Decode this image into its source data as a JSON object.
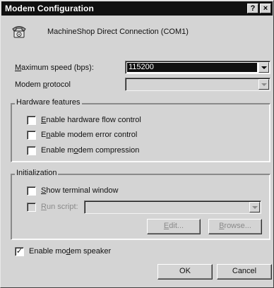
{
  "window": {
    "title": "Modem Configuration",
    "help_label": "?",
    "close_label": "×"
  },
  "device": {
    "icon": "phone-icon",
    "name": "MachineShop Direct Connection (COM1)"
  },
  "speed": {
    "label": "Maximum speed (bps):",
    "value": "115200"
  },
  "protocol": {
    "label": "Modem protocol",
    "value": ""
  },
  "hardware": {
    "legend": "Hardware features",
    "flow_control": {
      "label": "Enable hardware flow control",
      "checked": false
    },
    "error_control": {
      "label": "Enable modem error control",
      "checked": false
    },
    "compression": {
      "label": "Enable modem compression",
      "checked": false
    }
  },
  "init": {
    "legend": "Initialization",
    "show_terminal": {
      "label": "Show terminal window",
      "checked": false
    },
    "run_script": {
      "label": "Run script:",
      "checked": false,
      "value": ""
    },
    "edit_label": "Edit...",
    "browse_label": "Browse..."
  },
  "speaker": {
    "label": "Enable modem speaker",
    "checked": true,
    "check_mark": "✓"
  },
  "buttons": {
    "ok": "OK",
    "cancel": "Cancel"
  },
  "colors": {
    "titlebar": "#101010",
    "face": "#d4d4d4",
    "disabled_text": "#8a8a8a"
  }
}
